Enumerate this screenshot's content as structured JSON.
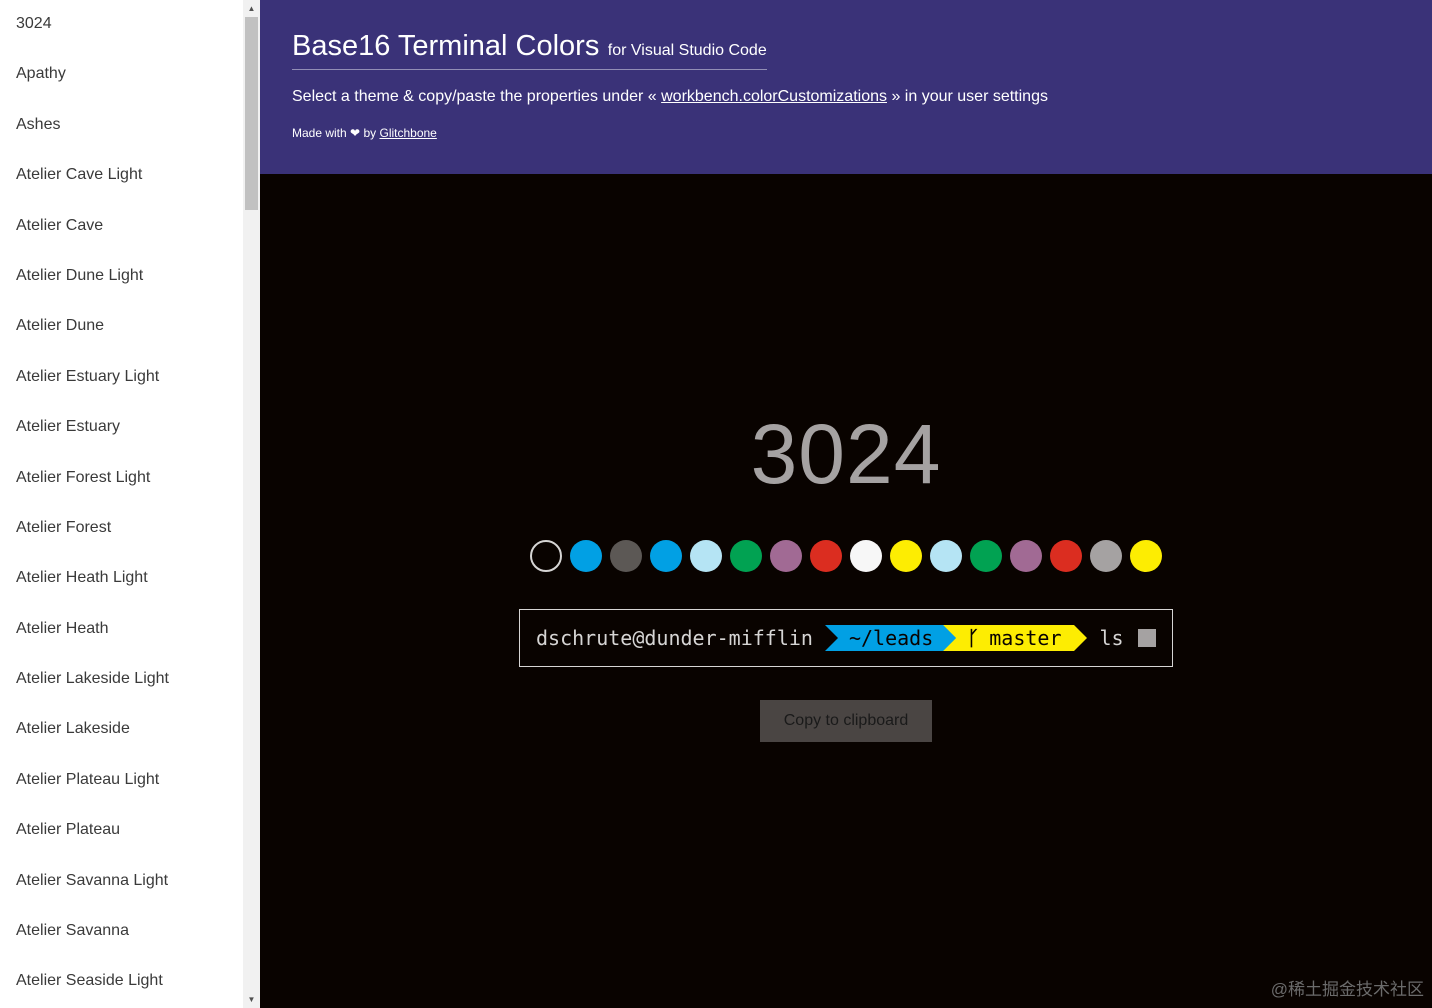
{
  "sidebar": {
    "items": [
      {
        "label": "3024"
      },
      {
        "label": "Apathy"
      },
      {
        "label": "Ashes"
      },
      {
        "label": "Atelier Cave Light"
      },
      {
        "label": "Atelier Cave"
      },
      {
        "label": "Atelier Dune Light"
      },
      {
        "label": "Atelier Dune"
      },
      {
        "label": "Atelier Estuary Light"
      },
      {
        "label": "Atelier Estuary"
      },
      {
        "label": "Atelier Forest Light"
      },
      {
        "label": "Atelier Forest"
      },
      {
        "label": "Atelier Heath Light"
      },
      {
        "label": "Atelier Heath"
      },
      {
        "label": "Atelier Lakeside Light"
      },
      {
        "label": "Atelier Lakeside"
      },
      {
        "label": "Atelier Plateau Light"
      },
      {
        "label": "Atelier Plateau"
      },
      {
        "label": "Atelier Savanna Light"
      },
      {
        "label": "Atelier Savanna"
      },
      {
        "label": "Atelier Seaside Light"
      }
    ]
  },
  "header": {
    "title": "Base16 Terminal Colors",
    "subtitle": "for Visual Studio Code",
    "instructions_prefix": "Select a theme & copy/paste the properties under «",
    "instructions_link": "workbench.colorCustomizations",
    "instructions_suffix": "» in your user settings",
    "credits_prefix": "Made with",
    "credits_by": "by",
    "credits_link": "Glitchbone",
    "heart_icon": "heart-icon"
  },
  "main": {
    "theme_name": "3024",
    "swatches": [
      {
        "color": "#090300",
        "outline": true
      },
      {
        "color": "#01a0e4"
      },
      {
        "color": "#5c5855"
      },
      {
        "color": "#01a0e4"
      },
      {
        "color": "#b5e4f4"
      },
      {
        "color": "#01a252"
      },
      {
        "color": "#a16a94"
      },
      {
        "color": "#db2d20"
      },
      {
        "color": "#f7f7f7"
      },
      {
        "color": "#fded02"
      },
      {
        "color": "#b5e4f4"
      },
      {
        "color": "#01a252"
      },
      {
        "color": "#a16a94"
      },
      {
        "color": "#db2d20"
      },
      {
        "color": "#a5a2a2"
      },
      {
        "color": "#fded02"
      }
    ],
    "terminal": {
      "user_host": "dschrute@dunder-mifflin",
      "directory": "~/leads",
      "branch": "master",
      "branch_icon": "git-branch-icon",
      "command": "ls"
    },
    "copy_button_label": "Copy to clipboard"
  },
  "watermark": "@稀土掘金技术社区",
  "colors": {
    "header_bg": "#3a3278",
    "main_bg": "#090300",
    "sidebar_bg": "#ffffff"
  }
}
